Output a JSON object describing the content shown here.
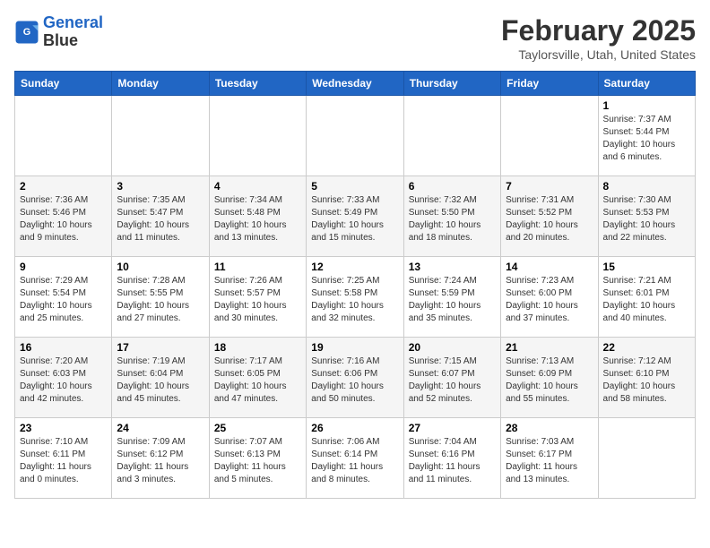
{
  "header": {
    "logo_line1": "General",
    "logo_line2": "Blue",
    "month": "February 2025",
    "location": "Taylorsville, Utah, United States"
  },
  "days_of_week": [
    "Sunday",
    "Monday",
    "Tuesday",
    "Wednesday",
    "Thursday",
    "Friday",
    "Saturday"
  ],
  "weeks": [
    [
      {
        "day": "",
        "info": ""
      },
      {
        "day": "",
        "info": ""
      },
      {
        "day": "",
        "info": ""
      },
      {
        "day": "",
        "info": ""
      },
      {
        "day": "",
        "info": ""
      },
      {
        "day": "",
        "info": ""
      },
      {
        "day": "1",
        "info": "Sunrise: 7:37 AM\nSunset: 5:44 PM\nDaylight: 10 hours and 6 minutes."
      }
    ],
    [
      {
        "day": "2",
        "info": "Sunrise: 7:36 AM\nSunset: 5:46 PM\nDaylight: 10 hours and 9 minutes."
      },
      {
        "day": "3",
        "info": "Sunrise: 7:35 AM\nSunset: 5:47 PM\nDaylight: 10 hours and 11 minutes."
      },
      {
        "day": "4",
        "info": "Sunrise: 7:34 AM\nSunset: 5:48 PM\nDaylight: 10 hours and 13 minutes."
      },
      {
        "day": "5",
        "info": "Sunrise: 7:33 AM\nSunset: 5:49 PM\nDaylight: 10 hours and 15 minutes."
      },
      {
        "day": "6",
        "info": "Sunrise: 7:32 AM\nSunset: 5:50 PM\nDaylight: 10 hours and 18 minutes."
      },
      {
        "day": "7",
        "info": "Sunrise: 7:31 AM\nSunset: 5:52 PM\nDaylight: 10 hours and 20 minutes."
      },
      {
        "day": "8",
        "info": "Sunrise: 7:30 AM\nSunset: 5:53 PM\nDaylight: 10 hours and 22 minutes."
      }
    ],
    [
      {
        "day": "9",
        "info": "Sunrise: 7:29 AM\nSunset: 5:54 PM\nDaylight: 10 hours and 25 minutes."
      },
      {
        "day": "10",
        "info": "Sunrise: 7:28 AM\nSunset: 5:55 PM\nDaylight: 10 hours and 27 minutes."
      },
      {
        "day": "11",
        "info": "Sunrise: 7:26 AM\nSunset: 5:57 PM\nDaylight: 10 hours and 30 minutes."
      },
      {
        "day": "12",
        "info": "Sunrise: 7:25 AM\nSunset: 5:58 PM\nDaylight: 10 hours and 32 minutes."
      },
      {
        "day": "13",
        "info": "Sunrise: 7:24 AM\nSunset: 5:59 PM\nDaylight: 10 hours and 35 minutes."
      },
      {
        "day": "14",
        "info": "Sunrise: 7:23 AM\nSunset: 6:00 PM\nDaylight: 10 hours and 37 minutes."
      },
      {
        "day": "15",
        "info": "Sunrise: 7:21 AM\nSunset: 6:01 PM\nDaylight: 10 hours and 40 minutes."
      }
    ],
    [
      {
        "day": "16",
        "info": "Sunrise: 7:20 AM\nSunset: 6:03 PM\nDaylight: 10 hours and 42 minutes."
      },
      {
        "day": "17",
        "info": "Sunrise: 7:19 AM\nSunset: 6:04 PM\nDaylight: 10 hours and 45 minutes."
      },
      {
        "day": "18",
        "info": "Sunrise: 7:17 AM\nSunset: 6:05 PM\nDaylight: 10 hours and 47 minutes."
      },
      {
        "day": "19",
        "info": "Sunrise: 7:16 AM\nSunset: 6:06 PM\nDaylight: 10 hours and 50 minutes."
      },
      {
        "day": "20",
        "info": "Sunrise: 7:15 AM\nSunset: 6:07 PM\nDaylight: 10 hours and 52 minutes."
      },
      {
        "day": "21",
        "info": "Sunrise: 7:13 AM\nSunset: 6:09 PM\nDaylight: 10 hours and 55 minutes."
      },
      {
        "day": "22",
        "info": "Sunrise: 7:12 AM\nSunset: 6:10 PM\nDaylight: 10 hours and 58 minutes."
      }
    ],
    [
      {
        "day": "23",
        "info": "Sunrise: 7:10 AM\nSunset: 6:11 PM\nDaylight: 11 hours and 0 minutes."
      },
      {
        "day": "24",
        "info": "Sunrise: 7:09 AM\nSunset: 6:12 PM\nDaylight: 11 hours and 3 minutes."
      },
      {
        "day": "25",
        "info": "Sunrise: 7:07 AM\nSunset: 6:13 PM\nDaylight: 11 hours and 5 minutes."
      },
      {
        "day": "26",
        "info": "Sunrise: 7:06 AM\nSunset: 6:14 PM\nDaylight: 11 hours and 8 minutes."
      },
      {
        "day": "27",
        "info": "Sunrise: 7:04 AM\nSunset: 6:16 PM\nDaylight: 11 hours and 11 minutes."
      },
      {
        "day": "28",
        "info": "Sunrise: 7:03 AM\nSunset: 6:17 PM\nDaylight: 11 hours and 13 minutes."
      },
      {
        "day": "",
        "info": ""
      }
    ]
  ]
}
